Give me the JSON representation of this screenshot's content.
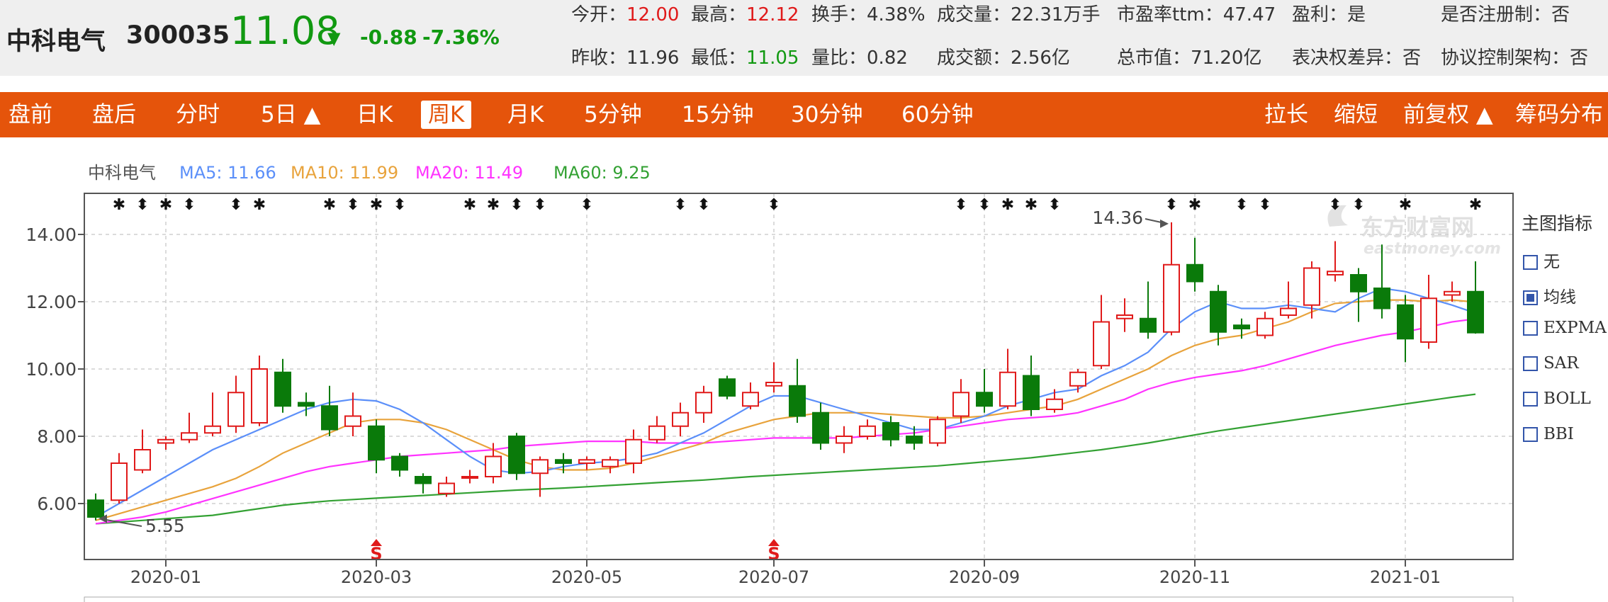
{
  "header": {
    "name": "中科电气",
    "code": "300035",
    "price": "11.08",
    "arrow": "▼",
    "change": "-0.88",
    "change_pct": "-7.36%",
    "stats_row1": [
      {
        "label": "今开：",
        "value": "12.00",
        "color": "red"
      },
      {
        "label": "最高：",
        "value": "12.12",
        "color": "red"
      },
      {
        "label": "换手：",
        "value": "4.38%",
        "color": "normal"
      },
      {
        "label": "成交量：",
        "value": "22.31万手",
        "color": "normal"
      },
      {
        "label": "市盈率ttm：",
        "value": "47.47",
        "color": "normal"
      },
      {
        "label": "盈利：",
        "value": "是",
        "color": "normal"
      },
      {
        "label": "是否注册制：",
        "value": "否",
        "color": "normal"
      }
    ],
    "stats_row2": [
      {
        "label": "昨收：",
        "value": "11.96",
        "color": "normal"
      },
      {
        "label": "最低：",
        "value": "11.05",
        "color": "green"
      },
      {
        "label": "量比：",
        "value": "0.82",
        "color": "normal"
      },
      {
        "label": "成交额：",
        "value": "2.56亿",
        "color": "normal"
      },
      {
        "label": "总市值：",
        "value": "71.20亿",
        "color": "normal"
      },
      {
        "label": "表决权差异：",
        "value": "否",
        "color": "normal"
      },
      {
        "label": "协议控制架构：",
        "value": "否",
        "color": "normal"
      }
    ]
  },
  "toolbar": {
    "tabs_left": [
      "盘前",
      "盘后",
      "分时",
      "5日 ▲",
      "日K",
      "周K",
      "月K",
      "5分钟",
      "15分钟",
      "30分钟",
      "60分钟"
    ],
    "active_tab": "周K",
    "tabs_right": [
      "拉长",
      "缩短",
      "前复权 ▲",
      "筹码分布"
    ]
  },
  "indicator_panel": {
    "title": "主图指标",
    "items": [
      {
        "label": "无",
        "checked": false
      },
      {
        "label": "均线",
        "checked": true
      },
      {
        "label": "EXPMA",
        "checked": false
      },
      {
        "label": "SAR",
        "checked": false
      },
      {
        "label": "BOLL",
        "checked": false
      },
      {
        "label": "BBI",
        "checked": false
      }
    ]
  },
  "chart_data": {
    "type": "candlestick",
    "legend": {
      "name": "中科电气",
      "items": [
        {
          "label": "MA5: 11.66",
          "color": "#5b8ff9"
        },
        {
          "label": "MA10: 11.99",
          "color": "#e8a33c"
        },
        {
          "label": "MA20: 11.49",
          "color": "#ff33ff"
        },
        {
          "label": "MA60: 9.25",
          "color": "#33a133"
        }
      ]
    },
    "ylim": [
      5.0,
      15.0
    ],
    "y_ticks": [
      "6.00",
      "8.00",
      "10.00",
      "12.00",
      "14.00"
    ],
    "x_ticks": [
      {
        "label": "2020-01",
        "index": 3
      },
      {
        "label": "2020-03",
        "index": 12
      },
      {
        "label": "2020-05",
        "index": 21
      },
      {
        "label": "2020-07",
        "index": 29
      },
      {
        "label": "2020-09",
        "index": 38
      },
      {
        "label": "2020-11",
        "index": 47
      },
      {
        "label": "2021-01",
        "index": 56
      }
    ],
    "candles": [
      [
        6.1,
        5.6,
        6.3,
        5.5
      ],
      [
        6.1,
        7.2,
        7.5,
        6.0
      ],
      [
        7.0,
        7.6,
        8.2,
        6.9
      ],
      [
        7.8,
        7.9,
        8.0,
        7.6
      ],
      [
        7.9,
        8.1,
        8.7,
        7.8
      ],
      [
        8.1,
        8.3,
        9.3,
        8.0
      ],
      [
        8.3,
        9.3,
        9.8,
        8.1
      ],
      [
        8.4,
        10.0,
        10.4,
        8.3
      ],
      [
        9.9,
        8.9,
        10.3,
        8.7
      ],
      [
        9.0,
        8.9,
        9.3,
        8.6
      ],
      [
        8.9,
        8.2,
        9.5,
        8.0
      ],
      [
        8.3,
        8.6,
        9.3,
        8.0
      ],
      [
        8.3,
        7.3,
        8.5,
        6.9
      ],
      [
        7.4,
        7.0,
        7.5,
        6.8
      ],
      [
        6.8,
        6.6,
        6.9,
        6.3
      ],
      [
        6.3,
        6.6,
        6.8,
        6.2
      ],
      [
        6.8,
        6.8,
        7.0,
        6.6
      ],
      [
        6.8,
        7.4,
        7.8,
        6.6
      ],
      [
        8.0,
        6.9,
        8.1,
        6.7
      ],
      [
        6.9,
        7.3,
        7.4,
        6.2
      ],
      [
        7.3,
        7.2,
        7.5,
        6.9
      ],
      [
        7.2,
        7.3,
        7.4,
        7.0
      ],
      [
        7.1,
        7.3,
        7.4,
        6.9
      ],
      [
        7.2,
        7.9,
        8.2,
        6.9
      ],
      [
        7.9,
        8.3,
        8.6,
        7.8
      ],
      [
        8.3,
        8.7,
        9.0,
        8.0
      ],
      [
        8.7,
        9.3,
        9.5,
        8.4
      ],
      [
        9.7,
        9.2,
        9.8,
        9.1
      ],
      [
        8.9,
        9.3,
        9.6,
        8.8
      ],
      [
        9.5,
        9.6,
        10.2,
        9.3
      ],
      [
        9.5,
        8.6,
        10.3,
        8.4
      ],
      [
        8.7,
        7.8,
        9.0,
        7.6
      ],
      [
        7.8,
        8.0,
        8.3,
        7.5
      ],
      [
        8.0,
        8.3,
        8.5,
        7.9
      ],
      [
        8.4,
        7.9,
        8.6,
        7.7
      ],
      [
        8.0,
        7.8,
        8.3,
        7.6
      ],
      [
        7.8,
        8.5,
        8.6,
        7.7
      ],
      [
        8.6,
        9.3,
        9.7,
        8.4
      ],
      [
        9.3,
        8.9,
        10.0,
        8.7
      ],
      [
        8.9,
        9.9,
        10.6,
        8.8
      ],
      [
        9.8,
        8.8,
        10.4,
        8.6
      ],
      [
        8.8,
        9.1,
        9.4,
        8.7
      ],
      [
        9.5,
        9.9,
        10.0,
        9.3
      ],
      [
        10.1,
        11.4,
        12.2,
        10.0
      ],
      [
        11.5,
        11.6,
        12.1,
        11.1
      ],
      [
        11.5,
        11.1,
        12.6,
        10.9
      ],
      [
        11.1,
        13.1,
        14.36,
        11.0
      ],
      [
        13.1,
        12.6,
        13.9,
        12.3
      ],
      [
        12.3,
        11.1,
        12.5,
        10.7
      ],
      [
        11.3,
        11.2,
        11.5,
        10.9
      ],
      [
        11.0,
        11.5,
        11.7,
        10.9
      ],
      [
        11.6,
        11.8,
        12.6,
        11.5
      ],
      [
        11.9,
        13.0,
        13.2,
        11.5
      ],
      [
        12.8,
        12.9,
        13.8,
        12.6
      ],
      [
        12.8,
        12.3,
        13.0,
        11.4
      ],
      [
        12.4,
        11.8,
        13.7,
        11.5
      ],
      [
        11.9,
        10.9,
        12.2,
        10.2
      ],
      [
        10.8,
        12.1,
        12.8,
        10.6
      ],
      [
        12.2,
        12.3,
        12.6,
        12.0
      ],
      [
        12.3,
        11.08,
        13.2,
        11.05
      ]
    ],
    "ma5": [
      5.6,
      6.0,
      6.4,
      6.8,
      7.2,
      7.6,
      7.9,
      8.2,
      8.5,
      8.8,
      9.0,
      9.1,
      9.05,
      8.8,
      8.4,
      7.9,
      7.4,
      7.0,
      6.9,
      6.95,
      7.1,
      7.2,
      7.25,
      7.35,
      7.5,
      7.8,
      8.1,
      8.5,
      8.9,
      9.2,
      9.2,
      9.0,
      8.8,
      8.6,
      8.4,
      8.2,
      8.2,
      8.4,
      8.6,
      8.9,
      9.1,
      9.3,
      9.4,
      9.8,
      10.1,
      10.5,
      11.2,
      11.7,
      12.0,
      11.8,
      11.8,
      11.9,
      11.8,
      11.7,
      12.1,
      12.4,
      12.3,
      12.1,
      11.9,
      11.66
    ],
    "ma10": [
      5.5,
      5.7,
      5.9,
      6.1,
      6.3,
      6.5,
      6.75,
      7.1,
      7.5,
      7.8,
      8.1,
      8.4,
      8.5,
      8.5,
      8.4,
      8.2,
      7.9,
      7.6,
      7.3,
      7.1,
      7.0,
      7.0,
      7.05,
      7.2,
      7.4,
      7.6,
      7.8,
      8.1,
      8.3,
      8.5,
      8.6,
      8.7,
      8.7,
      8.7,
      8.65,
      8.6,
      8.55,
      8.55,
      8.6,
      8.7,
      8.8,
      8.9,
      9.1,
      9.4,
      9.7,
      10.0,
      10.4,
      10.7,
      10.9,
      11.0,
      11.2,
      11.4,
      11.7,
      11.95,
      12.0,
      12.05,
      12.05,
      12.0,
      12.05,
      11.99
    ],
    "ma20": [
      5.4,
      5.5,
      5.6,
      5.75,
      5.95,
      6.15,
      6.35,
      6.55,
      6.75,
      6.95,
      7.1,
      7.2,
      7.3,
      7.4,
      7.45,
      7.5,
      7.55,
      7.6,
      7.7,
      7.75,
      7.8,
      7.85,
      7.85,
      7.85,
      7.8,
      7.8,
      7.8,
      7.85,
      7.9,
      7.95,
      7.95,
      7.95,
      7.95,
      8.0,
      8.05,
      8.1,
      8.2,
      8.3,
      8.4,
      8.5,
      8.55,
      8.6,
      8.7,
      8.9,
      9.1,
      9.4,
      9.6,
      9.75,
      9.85,
      9.95,
      10.1,
      10.3,
      10.5,
      10.7,
      10.85,
      11.0,
      11.1,
      11.25,
      11.4,
      11.49
    ],
    "ma60": [
      5.4,
      5.45,
      5.5,
      5.55,
      5.6,
      5.65,
      5.75,
      5.85,
      5.95,
      6.02,
      6.08,
      6.12,
      6.16,
      6.2,
      6.24,
      6.28,
      6.32,
      6.36,
      6.4,
      6.43,
      6.46,
      6.5,
      6.54,
      6.58,
      6.62,
      6.66,
      6.7,
      6.75,
      6.8,
      6.84,
      6.88,
      6.92,
      6.96,
      7.0,
      7.04,
      7.08,
      7.12,
      7.18,
      7.24,
      7.3,
      7.36,
      7.44,
      7.52,
      7.6,
      7.7,
      7.8,
      7.92,
      8.04,
      8.16,
      8.26,
      8.36,
      8.46,
      8.56,
      8.66,
      8.76,
      8.86,
      8.96,
      9.06,
      9.16,
      9.25
    ],
    "annotations": [
      {
        "label": "14.36",
        "index": 46,
        "value": 14.36
      },
      {
        "label": "5.55",
        "index": 0,
        "value": 5.55
      }
    ],
    "top_markers": [
      {
        "index": 1,
        "glyph": "✱"
      },
      {
        "index": 2,
        "glyph": "⬍"
      },
      {
        "index": 3,
        "glyph": "✱"
      },
      {
        "index": 4,
        "glyph": "⬍"
      },
      {
        "index": 6,
        "glyph": "⬍"
      },
      {
        "index": 7,
        "glyph": "✱"
      },
      {
        "index": 10,
        "glyph": "✱"
      },
      {
        "index": 11,
        "glyph": "⬍"
      },
      {
        "index": 12,
        "glyph": "✱"
      },
      {
        "index": 13,
        "glyph": "⬍"
      },
      {
        "index": 16,
        "glyph": "✱"
      },
      {
        "index": 17,
        "glyph": "✱"
      },
      {
        "index": 18,
        "glyph": "⬍"
      },
      {
        "index": 19,
        "glyph": "⬍"
      },
      {
        "index": 21,
        "glyph": "⬍"
      },
      {
        "index": 25,
        "glyph": "⬍"
      },
      {
        "index": 26,
        "glyph": "⬍"
      },
      {
        "index": 29,
        "glyph": "⬍"
      },
      {
        "index": 37,
        "glyph": "⬍"
      },
      {
        "index": 38,
        "glyph": "⬍"
      },
      {
        "index": 39,
        "glyph": "✱"
      },
      {
        "index": 40,
        "glyph": "✱"
      },
      {
        "index": 41,
        "glyph": "⬍"
      },
      {
        "index": 46,
        "glyph": "⬍"
      },
      {
        "index": 47,
        "glyph": "✱"
      },
      {
        "index": 49,
        "glyph": "⬍"
      },
      {
        "index": 50,
        "glyph": "⬍"
      },
      {
        "index": 53,
        "glyph": "⬍"
      },
      {
        "index": 54,
        "glyph": "⬍"
      },
      {
        "index": 56,
        "glyph": "✱"
      },
      {
        "index": 59,
        "glyph": "✱"
      }
    ],
    "bottom_markers": [
      {
        "index": 12,
        "label": "S"
      },
      {
        "index": 29,
        "label": "S"
      }
    ],
    "watermark": {
      "cn": "东方财富网",
      "en": "eastmoney.com"
    }
  }
}
